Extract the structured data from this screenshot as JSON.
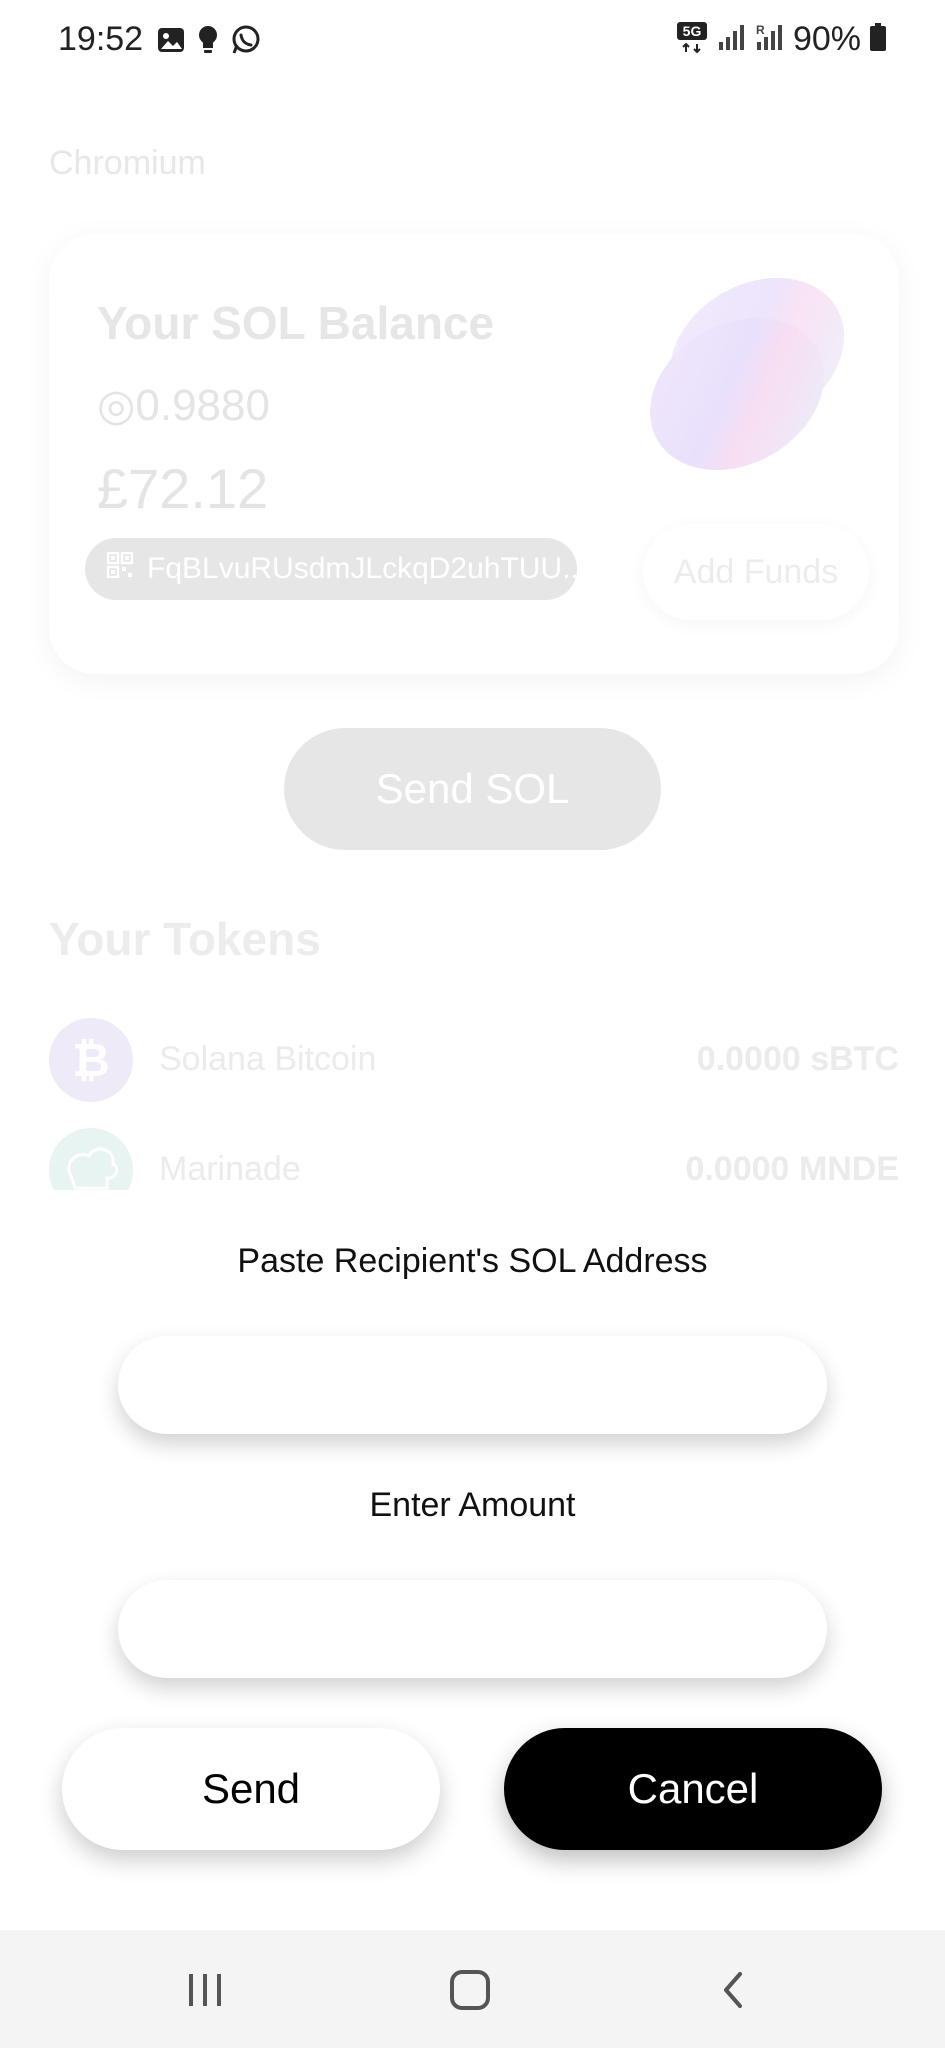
{
  "status_bar": {
    "time": "19:52",
    "network": "5G",
    "battery": "90%",
    "left_icons": [
      "image-icon",
      "bulb-icon",
      "whatsapp-icon"
    ],
    "right_icons": [
      "5g-icon",
      "signal-icon",
      "roaming-signal-icon",
      "battery-icon"
    ]
  },
  "browser": {
    "label": "Chromium"
  },
  "wallet": {
    "title": "Your SOL Balance",
    "sol_balance": "◎0.9880",
    "fiat_balance": "£72.12",
    "address": "FqBLvuRUsdmJLckqD2uhTUU...",
    "add_funds_label": "Add Funds",
    "send_sol_label": "Send SOL"
  },
  "tokens": {
    "title": "Your Tokens",
    "items": [
      {
        "name": "Solana Bitcoin",
        "amount": "0.0000 sBTC",
        "icon": "bitcoin-icon"
      },
      {
        "name": "Marinade",
        "amount": "0.0000 MNDE",
        "icon": "marinade-chef-icon"
      }
    ]
  },
  "dialog": {
    "address_label": "Paste Recipient's SOL Address",
    "address_value": "",
    "amount_label": "Enter Amount",
    "amount_value": "",
    "send_label": "Send",
    "cancel_label": "Cancel"
  },
  "nav": {
    "icons": [
      "recent-apps-icon",
      "home-icon",
      "back-icon"
    ]
  },
  "colors": {
    "cancel_bg": "#000000",
    "dimmed_text": "#e6e6e6",
    "nav_bg": "#f4f4f4"
  }
}
